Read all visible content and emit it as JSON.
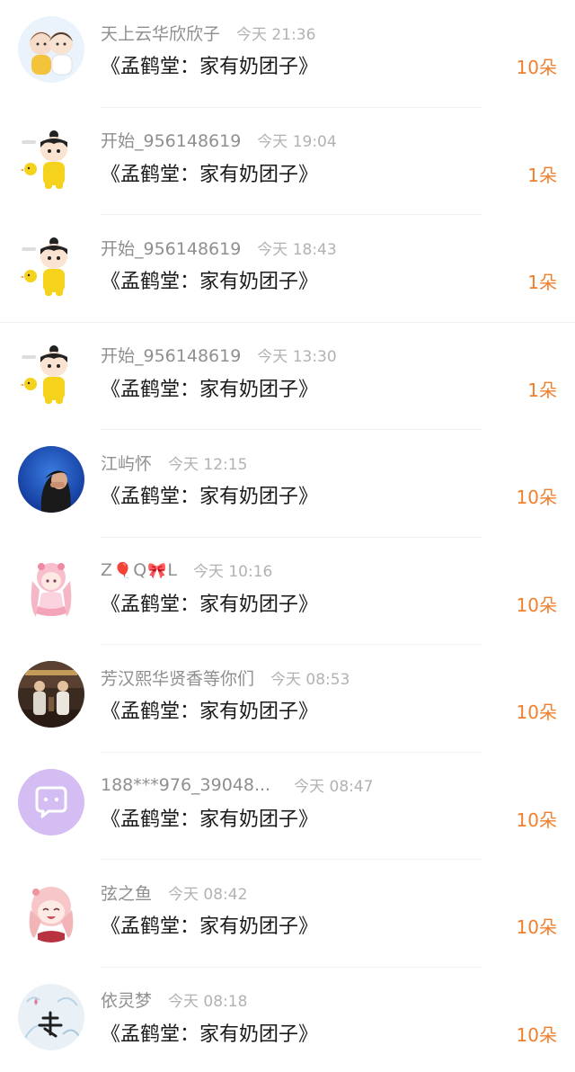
{
  "colors": {
    "accent_orange": "#f07f2c",
    "username_gray": "#8f8f8f",
    "time_gray": "#b2b2b2",
    "title_black": "#1a1a1a"
  },
  "items": [
    {
      "avatar": "couple-cartoon-avatar",
      "username": "天上云华欣欣子",
      "time": "今天 21:36",
      "title": "《孟鹤堂：家有奶团子》",
      "count": "10朵"
    },
    {
      "avatar": "boy-yellow-suit-avatar",
      "username": "开始_956148619",
      "time": "今天 19:04",
      "title": "《孟鹤堂：家有奶团子》",
      "count": "1朵"
    },
    {
      "avatar": "boy-yellow-suit-avatar",
      "username": "开始_956148619",
      "time": "今天 18:43",
      "title": "《孟鹤堂：家有奶团子》",
      "count": "1朵"
    },
    {
      "avatar": "boy-yellow-suit-avatar",
      "username": "开始_956148619",
      "time": "今天 13:30",
      "title": "《孟鹤堂：家有奶团子》",
      "count": "1朵"
    },
    {
      "avatar": "person-blue-background-avatar",
      "username": "江屿怀",
      "time": "今天 12:15",
      "title": "《孟鹤堂：家有奶团子》",
      "count": "10朵"
    },
    {
      "avatar": "pink-anime-girl-avatar",
      "username_parts": [
        "Z",
        "Q",
        "L"
      ],
      "username_emojis": [
        "🎈",
        "🎀"
      ],
      "time": "今天 10:16",
      "title": "《孟鹤堂：家有奶团子》",
      "count": "10朵"
    },
    {
      "avatar": "stage-performers-avatar",
      "username": "芳汉熙华贤香等你们",
      "time": "今天 08:53",
      "title": "《孟鹤堂：家有奶团子》",
      "count": "10朵"
    },
    {
      "avatar": "purple-chat-bubble-avatar",
      "username": "188***976_39048...",
      "time": "今天 08:47",
      "title": "《孟鹤堂：家有奶团子》",
      "count": "10朵"
    },
    {
      "avatar": "laughing-anime-girl-avatar",
      "username": "弦之鱼",
      "time": "今天 08:42",
      "title": "《孟鹤堂：家有奶团子》",
      "count": "10朵"
    },
    {
      "avatar": "dream-calligraphy-avatar",
      "username": "依灵梦",
      "time": "今天 08:18",
      "title": "《孟鹤堂：家有奶团子》",
      "count": "10朵"
    }
  ]
}
